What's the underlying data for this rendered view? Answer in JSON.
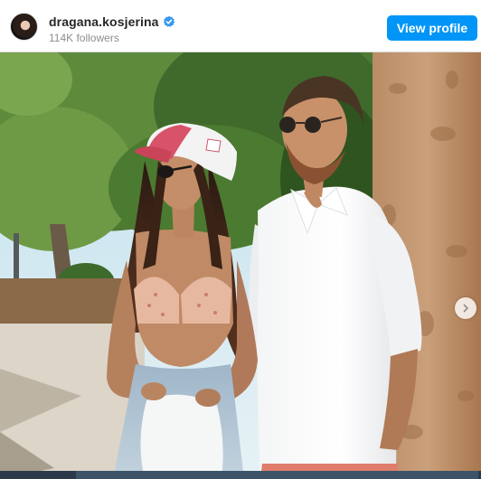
{
  "header": {
    "username": "dragana.kosjerina",
    "followers": "114K followers",
    "view_profile_label": "View profile",
    "verified_icon": "verified-badge-icon",
    "accent_color": "#0095f6"
  },
  "post": {
    "image_icon": "photo",
    "carousel_next_icon": "chevron-right-icon"
  }
}
